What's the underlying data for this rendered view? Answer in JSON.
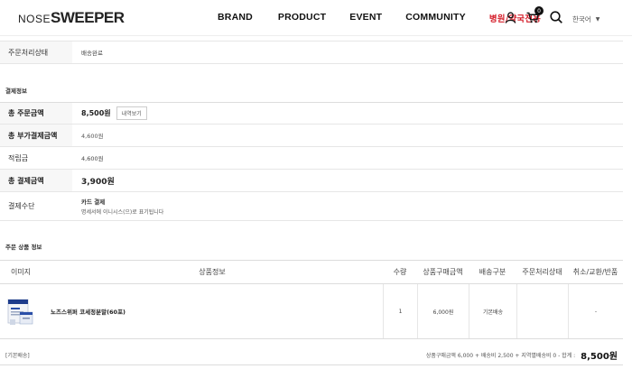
{
  "header": {
    "logo_part1": "NOSE",
    "logo_part2": "SWEEPER",
    "nav": [
      "BRAND",
      "PRODUCT",
      "EVENT",
      "COMMUNITY",
      "병원/약국전용"
    ],
    "cart_count": "0",
    "language": "한국어"
  },
  "order_status": {
    "label": "주문처리상태",
    "value": "배송완료"
  },
  "payment": {
    "section_title": "결제정보",
    "total_order_label": "총 주문금액",
    "total_order_value": "8,500원",
    "detail_button": "내역보기",
    "additional_label": "총 부가결제금액",
    "additional_value": "4,600원",
    "points_label": "적립금",
    "points_value": "4,600원",
    "total_paid_label": "총 결제금액",
    "total_paid_value": "3,900원",
    "method_label": "결제수단",
    "method_line1": "카드 결제",
    "method_line2": "명세서에 이니시스(으)로 표기됩니다"
  },
  "products": {
    "section_title": "주문 상품 정보",
    "columns": [
      "이미지",
      "상품정보",
      "수량",
      "상품구매금액",
      "배송구분",
      "주문처리상태",
      "취소/교환/반품"
    ],
    "rows": [
      {
        "name": "노즈스위퍼 코세정분말(60포)",
        "qty": "1",
        "price": "6,000원",
        "shipping": "기본배송",
        "status": "",
        "cancel": "-"
      }
    ]
  },
  "footer": {
    "shipping_type": "[기본배송]",
    "summary": "상품구매금액 6,000 + 배송비 2,500 + 지역별배송비 0 - 합계 :",
    "total": "8,500원"
  },
  "colors": {
    "accent_red": "#d51f2b",
    "label_bg": "#f7f7f7"
  }
}
